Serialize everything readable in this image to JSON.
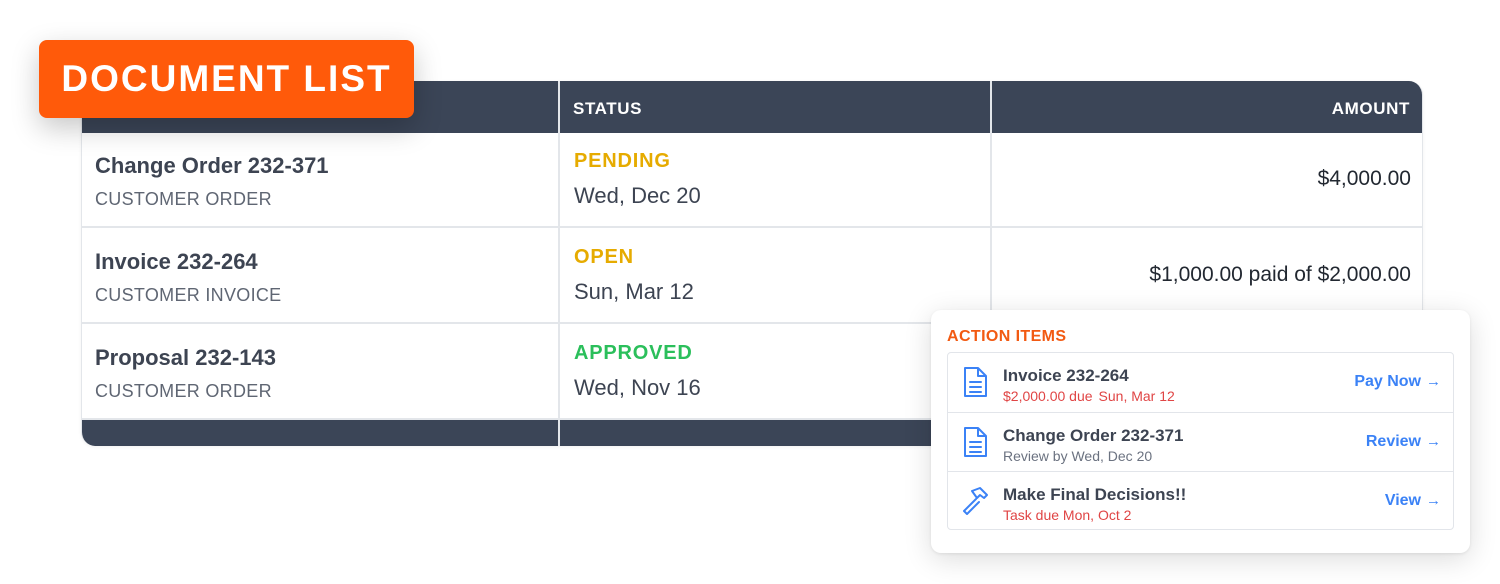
{
  "badge": {
    "title": "DOCUMENT LIST"
  },
  "table": {
    "headers": {
      "status": "STATUS",
      "amount": "AMOUNT"
    },
    "rows": [
      {
        "title": "Change Order 232-371",
        "type": "CUSTOMER ORDER",
        "status": "PENDING",
        "status_color": "#e6ab00",
        "date": "Wed, Dec 20",
        "amount": "$4,000.00"
      },
      {
        "title": "Invoice 232-264",
        "type": "CUSTOMER INVOICE",
        "status": "OPEN",
        "status_color": "#e6ab00",
        "date": "Sun, Mar 12",
        "amount": "$1,000.00 paid of $2,000.00"
      },
      {
        "title": "Proposal 232-143",
        "type": "CUSTOMER ORDER",
        "status": "APPROVED",
        "status_color": "#2bbf5b",
        "date": "Wed, Nov 16",
        "amount": ""
      }
    ]
  },
  "action_items": {
    "heading": "ACTION ITEMS",
    "items": [
      {
        "icon": "document-icon",
        "title": "Invoice 232-264",
        "sub_amount": "$2,000.00 due",
        "sub_date": "Sun, Mar 12",
        "link": "Pay Now"
      },
      {
        "icon": "document-icon",
        "title": "Change Order 232-371",
        "sub": "Review by Wed, Dec 20",
        "link": "Review"
      },
      {
        "icon": "hammer-icon",
        "title": "Make Final Decisions!!",
        "sub": "Task due Mon, Oct 2",
        "link": "View"
      }
    ],
    "link_arrow": "→"
  },
  "colors": {
    "brand_orange": "#ff5a0a",
    "table_header": "#3b4557",
    "link_blue": "#3b82f6",
    "due_red": "#e04545",
    "pending_yellow": "#e6ab00",
    "approved_green": "#2bbf5b"
  }
}
